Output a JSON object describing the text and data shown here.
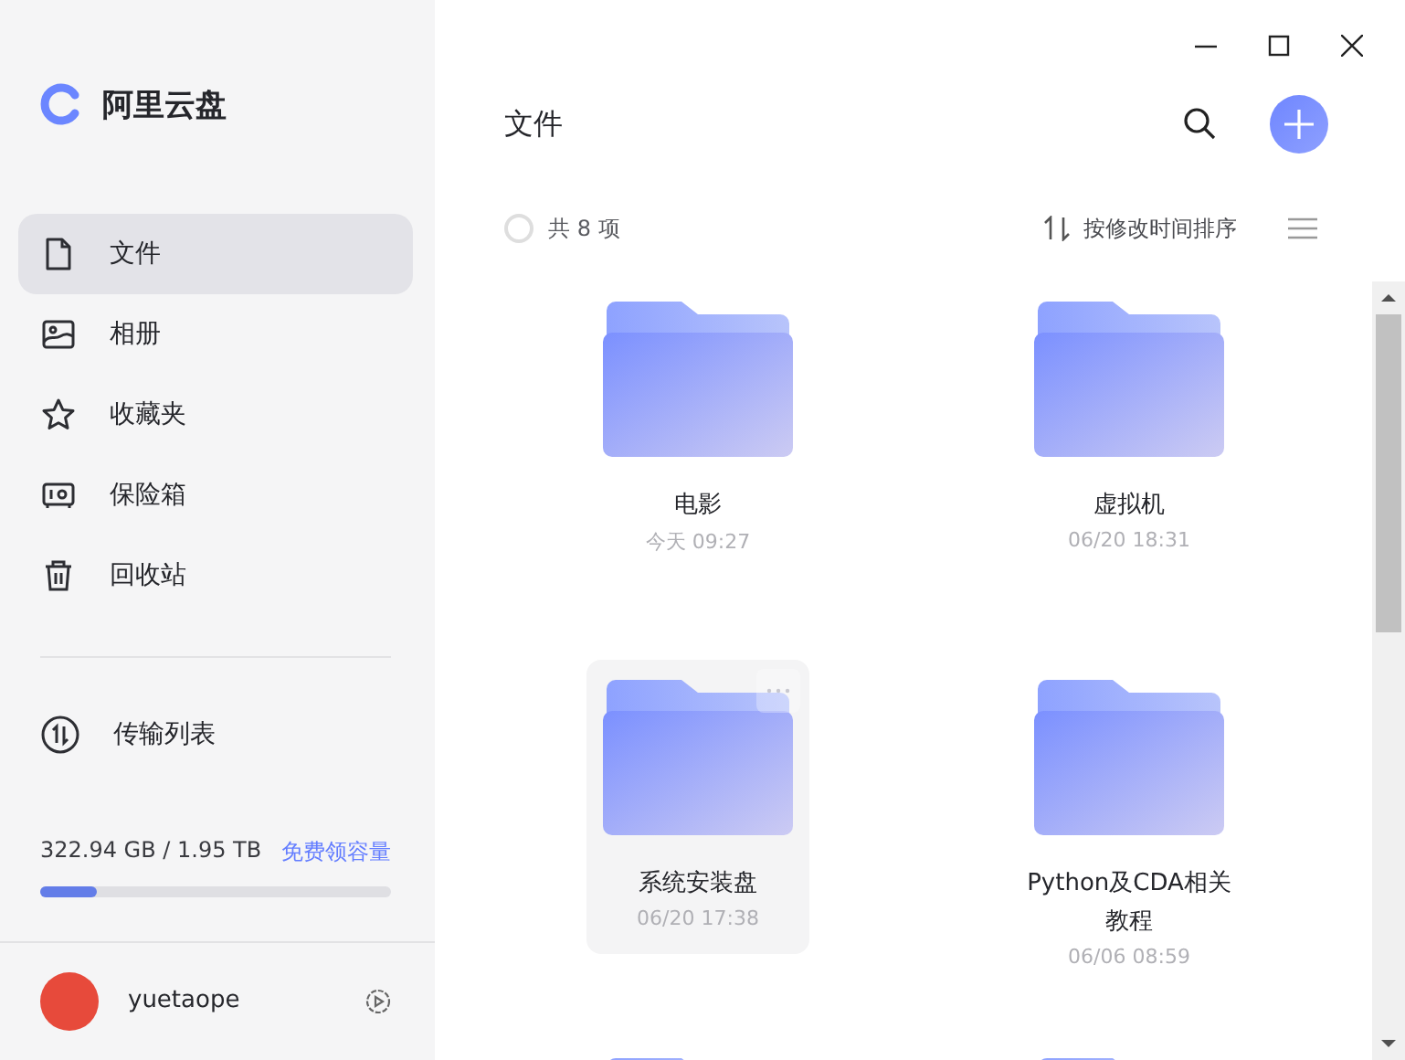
{
  "app": {
    "name": "阿里云盘"
  },
  "nav": [
    {
      "label": "文件",
      "selected": true
    },
    {
      "label": "相册",
      "selected": false
    },
    {
      "label": "收藏夹",
      "selected": false
    },
    {
      "label": "保险箱",
      "selected": false
    },
    {
      "label": "回收站",
      "selected": false
    }
  ],
  "transfer": {
    "label": "传输列表"
  },
  "storage": {
    "usage": "322.94 GB / 1.95 TB",
    "link": "免费领容量",
    "level": 0.16
  },
  "user": {
    "name": "yuetaope"
  },
  "header": {
    "title": "文件"
  },
  "toolbar": {
    "checked": false,
    "count": "共 8 项",
    "sort": "按修改时间排序"
  },
  "folders": [
    {
      "name": "电影",
      "date": "今天 09:27",
      "hovered": false
    },
    {
      "name": "虚拟机",
      "date": "06/20 18:31",
      "hovered": false
    },
    {
      "name": "系统安装盘",
      "date": "06/20 17:38",
      "hovered": true
    },
    {
      "name": "Python及CDA相关教程",
      "date": "06/06 08:59",
      "hovered": false
    }
  ]
}
